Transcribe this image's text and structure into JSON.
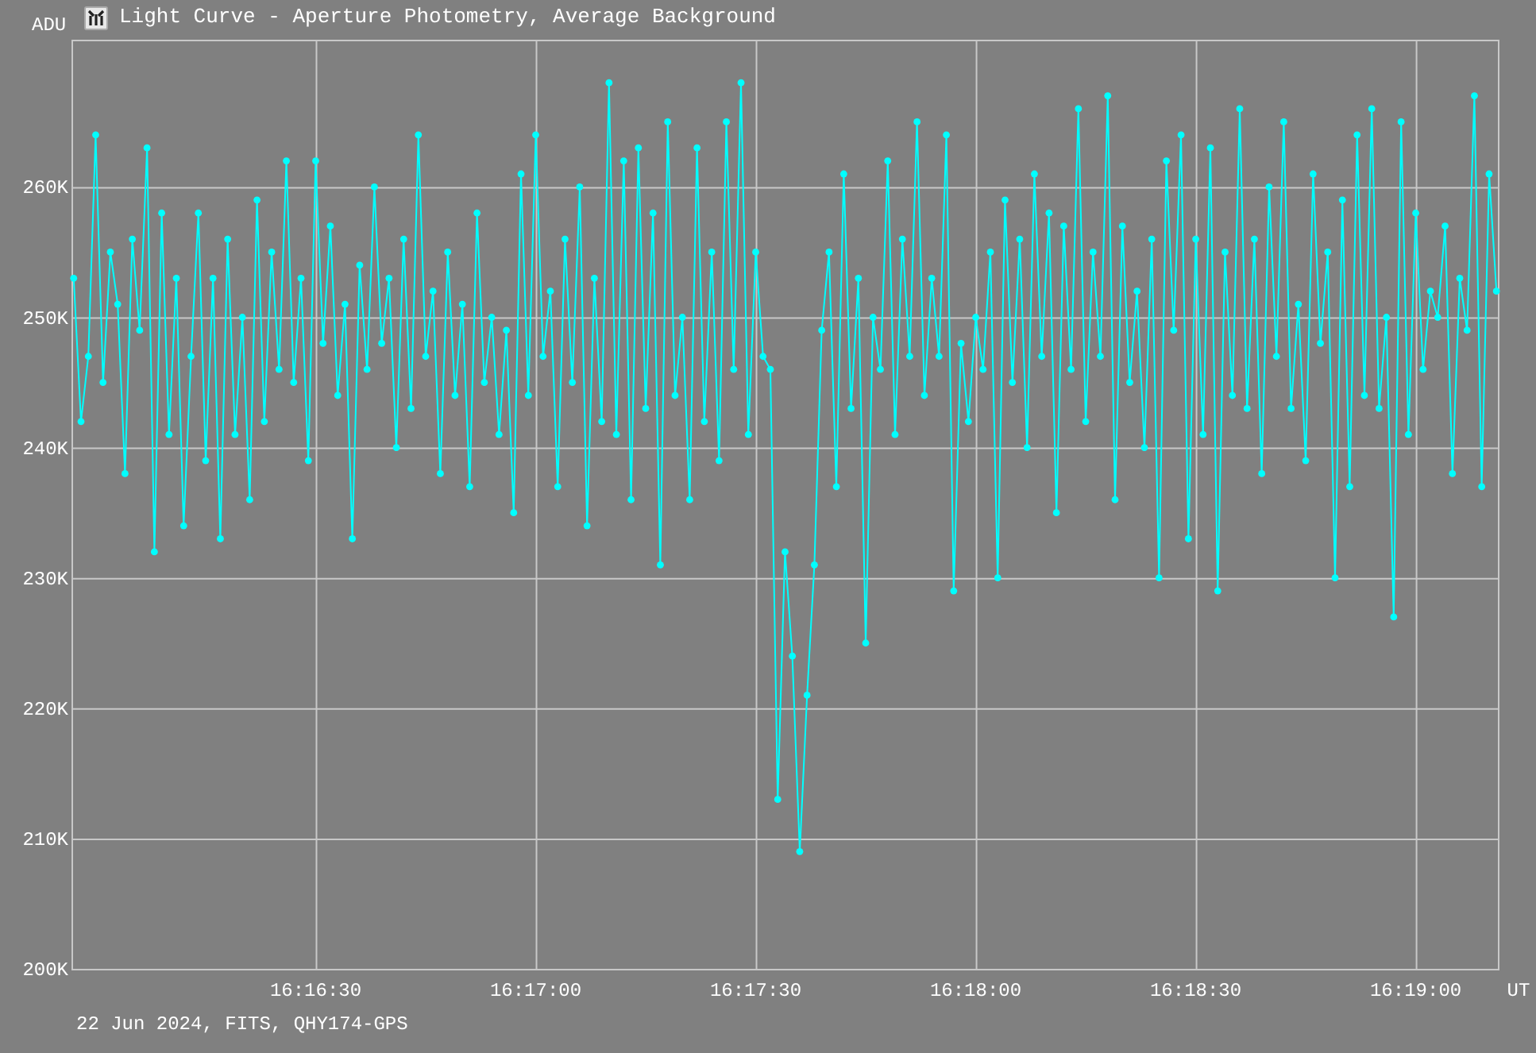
{
  "window": {
    "title": "Light Curve - Aperture Photometry, Average Background"
  },
  "chart": {
    "chart_data": {
      "type": "line",
      "ylabel": "ADU",
      "xlabel": "UT",
      "categories": [
        null,
        null,
        null,
        null,
        null,
        null,
        null,
        null,
        null,
        null,
        null,
        null,
        null,
        null,
        null,
        null,
        null,
        null,
        null,
        null,
        null,
        null,
        null,
        null,
        null,
        null,
        null,
        null,
        null,
        null,
        null,
        null,
        null,
        "16:16:30",
        null,
        null,
        null,
        null,
        null,
        null,
        null,
        null,
        null,
        null,
        null,
        null,
        null,
        null,
        null,
        null,
        null,
        null,
        null,
        null,
        null,
        null,
        null,
        null,
        null,
        null,
        null,
        null,
        null,
        "16:17:00",
        null,
        null,
        null,
        null,
        null,
        null,
        null,
        null,
        null,
        null,
        null,
        null,
        null,
        null,
        null,
        null,
        null,
        null,
        null,
        null,
        null,
        null,
        null,
        null,
        null,
        null,
        null,
        null,
        null,
        "16:17:30",
        null,
        null,
        null,
        null,
        null,
        null,
        null,
        null,
        null,
        null,
        null,
        null,
        null,
        null,
        null,
        null,
        null,
        null,
        null,
        null,
        null,
        null,
        null,
        null,
        null,
        null,
        null,
        null,
        null,
        "16:18:00",
        null,
        null,
        null,
        null,
        null,
        null,
        null,
        null,
        null,
        null,
        null,
        null,
        null,
        null,
        null,
        null,
        null,
        null,
        null,
        null,
        null,
        null,
        null,
        null,
        null,
        null,
        null,
        null,
        null,
        "16:18:30",
        null,
        null,
        null,
        null,
        null,
        null,
        null,
        null,
        null,
        null,
        null,
        null,
        null,
        null,
        null,
        null,
        null,
        null,
        null,
        null,
        null,
        null,
        null,
        null,
        null,
        null,
        null,
        null,
        null,
        "16:19:00",
        null,
        null,
        null,
        null,
        null,
        null,
        null,
        null,
        null,
        null,
        null
      ],
      "grid": true,
      "series": [
        {
          "color": "#00ffff",
          "marker": "circle",
          "values": [
            253,
            242,
            247,
            264,
            245,
            255,
            251,
            238,
            256,
            249,
            263,
            232,
            258,
            241,
            253,
            234,
            247,
            258,
            239,
            253,
            233,
            256,
            241,
            250,
            236,
            259,
            242,
            255,
            246,
            262,
            245,
            253,
            239,
            262,
            248,
            257,
            244,
            251,
            233,
            254,
            246,
            260,
            248,
            253,
            240,
            256,
            243,
            264,
            247,
            252,
            238,
            255,
            244,
            251,
            237,
            258,
            245,
            250,
            241,
            249,
            235,
            261,
            244,
            264,
            247,
            252,
            237,
            256,
            245,
            260,
            234,
            253,
            242,
            268,
            241,
            262,
            236,
            263,
            243,
            258,
            231,
            265,
            244,
            250,
            236,
            263,
            242,
            255,
            239,
            265,
            246,
            268,
            241,
            255,
            247,
            246,
            213,
            232,
            224,
            209,
            221,
            231,
            249,
            255,
            237,
            261,
            243,
            253,
            225,
            250,
            246,
            262,
            241,
            256,
            247,
            265,
            244,
            253,
            247,
            264,
            229,
            248,
            242,
            250,
            246,
            255,
            230,
            259,
            245,
            256,
            240,
            261,
            247,
            258,
            235,
            257,
            246,
            266,
            242,
            255,
            247,
            267,
            236,
            257,
            245,
            252,
            240,
            256,
            230,
            262,
            249,
            264,
            233,
            256,
            241,
            263,
            229,
            255,
            244,
            266,
            243,
            256,
            238,
            260,
            247,
            265,
            243,
            251,
            239,
            261,
            248,
            255,
            230,
            259,
            237,
            264,
            244,
            266,
            243,
            250,
            227,
            265,
            241,
            258,
            246,
            252,
            250,
            257,
            238,
            253,
            249,
            267,
            237,
            261,
            252
          ]
        }
      ],
      "ylim": [
        200,
        271.3
      ],
      "yticks": [
        {
          "value": 200,
          "label": "200K"
        },
        {
          "value": 210,
          "label": "210K"
        },
        {
          "value": 220,
          "label": "220K"
        },
        {
          "value": 230,
          "label": "230K"
        },
        {
          "value": 240,
          "label": "240K"
        },
        {
          "value": 250,
          "label": "250K"
        },
        {
          "value": 260,
          "label": "260K"
        }
      ]
    }
  },
  "footer": "22 Jun 2024, FITS, QHY174-GPS"
}
